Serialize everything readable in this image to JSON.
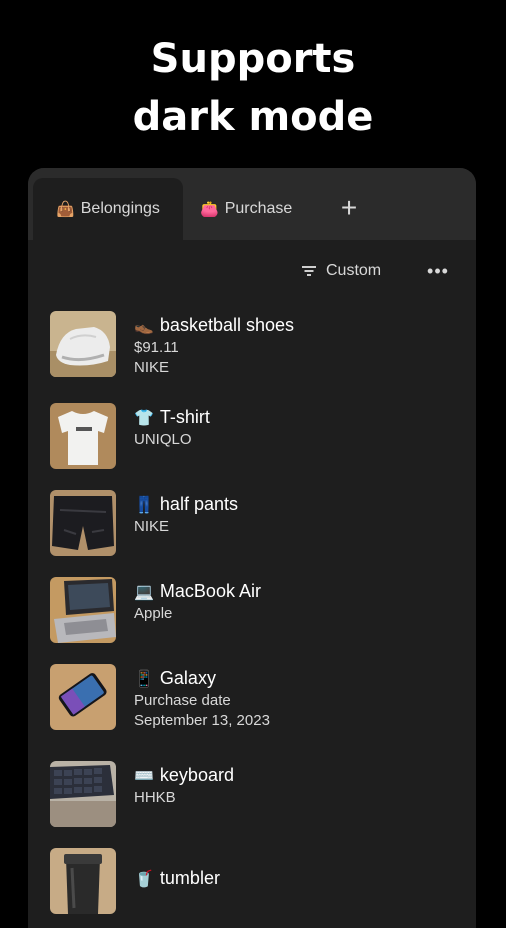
{
  "headline": {
    "line1": "Supports",
    "line2": "dark mode"
  },
  "tabs": [
    {
      "emoji": "👜",
      "label": "Belongings"
    },
    {
      "emoji": "👛",
      "label": "Purchase"
    }
  ],
  "add_tab_label": "+",
  "toolbar": {
    "sort_label": "Custom",
    "more_label": "•••"
  },
  "items": [
    {
      "emoji": "👞",
      "name": "basketball shoes",
      "lines": [
        "$91.11",
        "NIKE"
      ]
    },
    {
      "emoji": "👕",
      "name": "T-shirt",
      "lines": [
        "UNIQLO"
      ]
    },
    {
      "emoji": "👖",
      "name": "half pants",
      "lines": [
        "NIKE"
      ]
    },
    {
      "emoji": "💻",
      "name": "MacBook Air",
      "lines": [
        "Apple"
      ]
    },
    {
      "emoji": "📱",
      "name": "Galaxy",
      "lines": [
        "Purchase date",
        "September 13, 2023"
      ]
    },
    {
      "emoji": "⌨️",
      "name": "keyboard",
      "lines": [
        "HHKB"
      ]
    },
    {
      "emoji": "🥤",
      "name": "tumbler",
      "lines": []
    }
  ],
  "colors": {
    "background": "#000000",
    "panel": "#1e1e1e",
    "tabbar": "#2b2b2b",
    "text": "#ffffff",
    "subtext": "#d8d8d8"
  }
}
